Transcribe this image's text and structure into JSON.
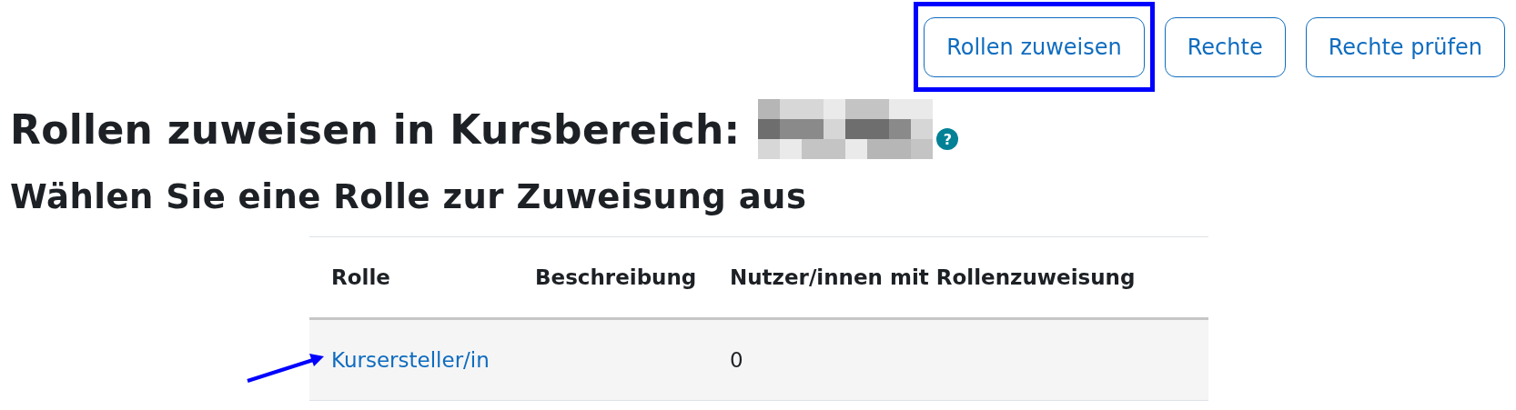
{
  "actions": [
    {
      "label": "Rollen zuweisen",
      "highlighted": true
    },
    {
      "label": "Rechte",
      "highlighted": false
    },
    {
      "label": "Rechte prüfen",
      "highlighted": false
    }
  ],
  "heading": {
    "text": "Rollen zuweisen in Kursbereich:",
    "redacted": true,
    "help": "?"
  },
  "subheading": "Wählen Sie eine Rolle zur Zuweisung aus",
  "table": {
    "columns": [
      "Rolle",
      "Beschreibung",
      "Nutzer/innen mit Rollenzuweisung"
    ],
    "rows": [
      {
        "role": "Kursersteller/in",
        "description_col": "",
        "count": "0",
        "pointed": true
      }
    ]
  }
}
